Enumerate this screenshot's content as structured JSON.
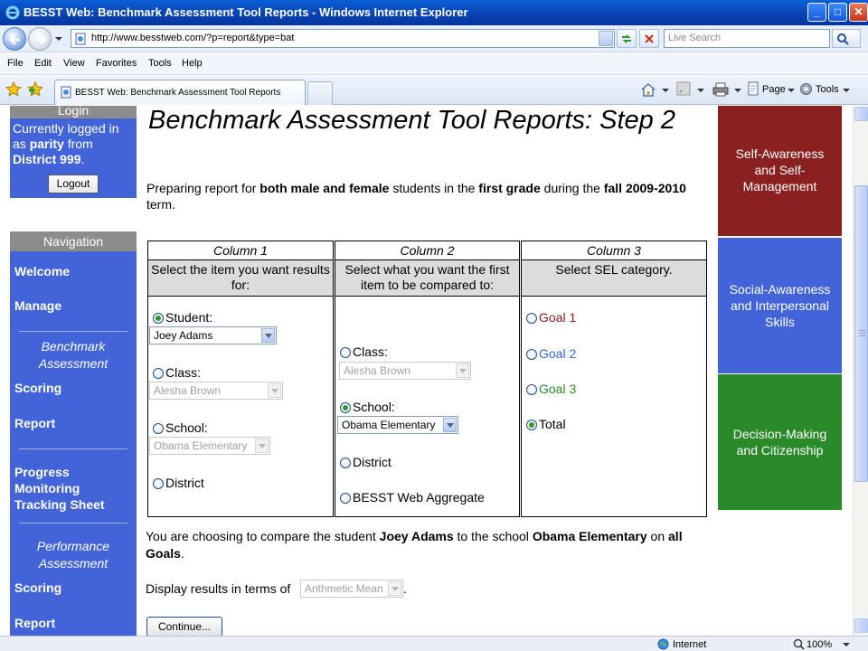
{
  "window": {
    "title": "BESST Web: Benchmark Assessment Tool Reports - Windows Internet Explorer",
    "min_label": "_",
    "max_label": "□",
    "close_label": "✕"
  },
  "address": {
    "url": "http://www.besstweb.com/?p=report&type=bat",
    "search_placeholder": "Live Search"
  },
  "menu": [
    "File",
    "Edit",
    "View",
    "Favorites",
    "Tools",
    "Help"
  ],
  "tab": {
    "label": "BESST Web: Benchmark Assessment Tool Reports"
  },
  "commands": {
    "page": "Page",
    "tools": "Tools"
  },
  "login": {
    "heading": "Login",
    "line1": "Currently logged in as ",
    "user": "parity",
    "line2": " from ",
    "district": "District 999",
    "line3": ".",
    "logout": "Logout"
  },
  "nav": {
    "heading": "Navigation",
    "welcome": "Welcome",
    "manage": "Manage",
    "benchmark_section": "Benchmark Assessment",
    "scoring1": "Scoring",
    "report1": "Report",
    "progress": "Progress Monitoring Tracking Sheet",
    "performance_section": "Performance Assessment",
    "scoring2": "Scoring",
    "report2": "Report"
  },
  "page": {
    "title": "Benchmark Assessment Tool Reports: Step 2",
    "intro": {
      "t1": "Preparing report for ",
      "b1": "both male and female",
      "t2": " students in the ",
      "b2": "first grade",
      "t3": " during the ",
      "b3": "fall 2009-2010",
      "t4": " term."
    }
  },
  "columns": [
    {
      "head": "Column 1",
      "sub": "Select the item you want results for:"
    },
    {
      "head": "Column 2",
      "sub": "Select what you want the first item to be compared to:"
    },
    {
      "head": "Column 3",
      "sub": "Select SEL category."
    }
  ],
  "col1": {
    "student": "Student:",
    "student_value": "Joey Adams",
    "class": "Class:",
    "class_value": "Alesha Brown",
    "school": "School:",
    "school_value": "Obama Elementary",
    "district": "District",
    "selected": "Student"
  },
  "col2": {
    "class": "Class:",
    "class_value": "Alesha Brown",
    "school": "School:",
    "school_value": "Obama Elementary",
    "district": "District",
    "aggregate": "BESST Web Aggregate",
    "selected": "School"
  },
  "col3": {
    "goal1": "Goal 1",
    "goal2": "Goal 2",
    "goal3": "Goal 3",
    "total": "Total",
    "selected": "Total",
    "colors": {
      "goal1": "#8b1a1a",
      "goal2": "#3a64d8",
      "goal3": "#2a8a2a"
    }
  },
  "summary": {
    "t1": "You are choosing to compare the student ",
    "b1": "Joey Adams",
    "t2": " to the school ",
    "b2": "Obama Elementary",
    "t3": " on ",
    "b3": "all Goals",
    "t4": "."
  },
  "display": {
    "label": "Display results in terms of",
    "value": "Arithmetic Mean",
    "trail": "."
  },
  "continue": "Continue...",
  "sel_blocks": [
    {
      "label": "Self-Awareness and Self-Management",
      "color": "#8b2020"
    },
    {
      "label": "Social-Awareness and Interpersonal Skills",
      "color": "#4364d8"
    },
    {
      "label": "Decision-Making and Citizenship",
      "color": "#2a8a2a"
    }
  ],
  "status": {
    "zone": "Internet",
    "zoom": "100%"
  }
}
